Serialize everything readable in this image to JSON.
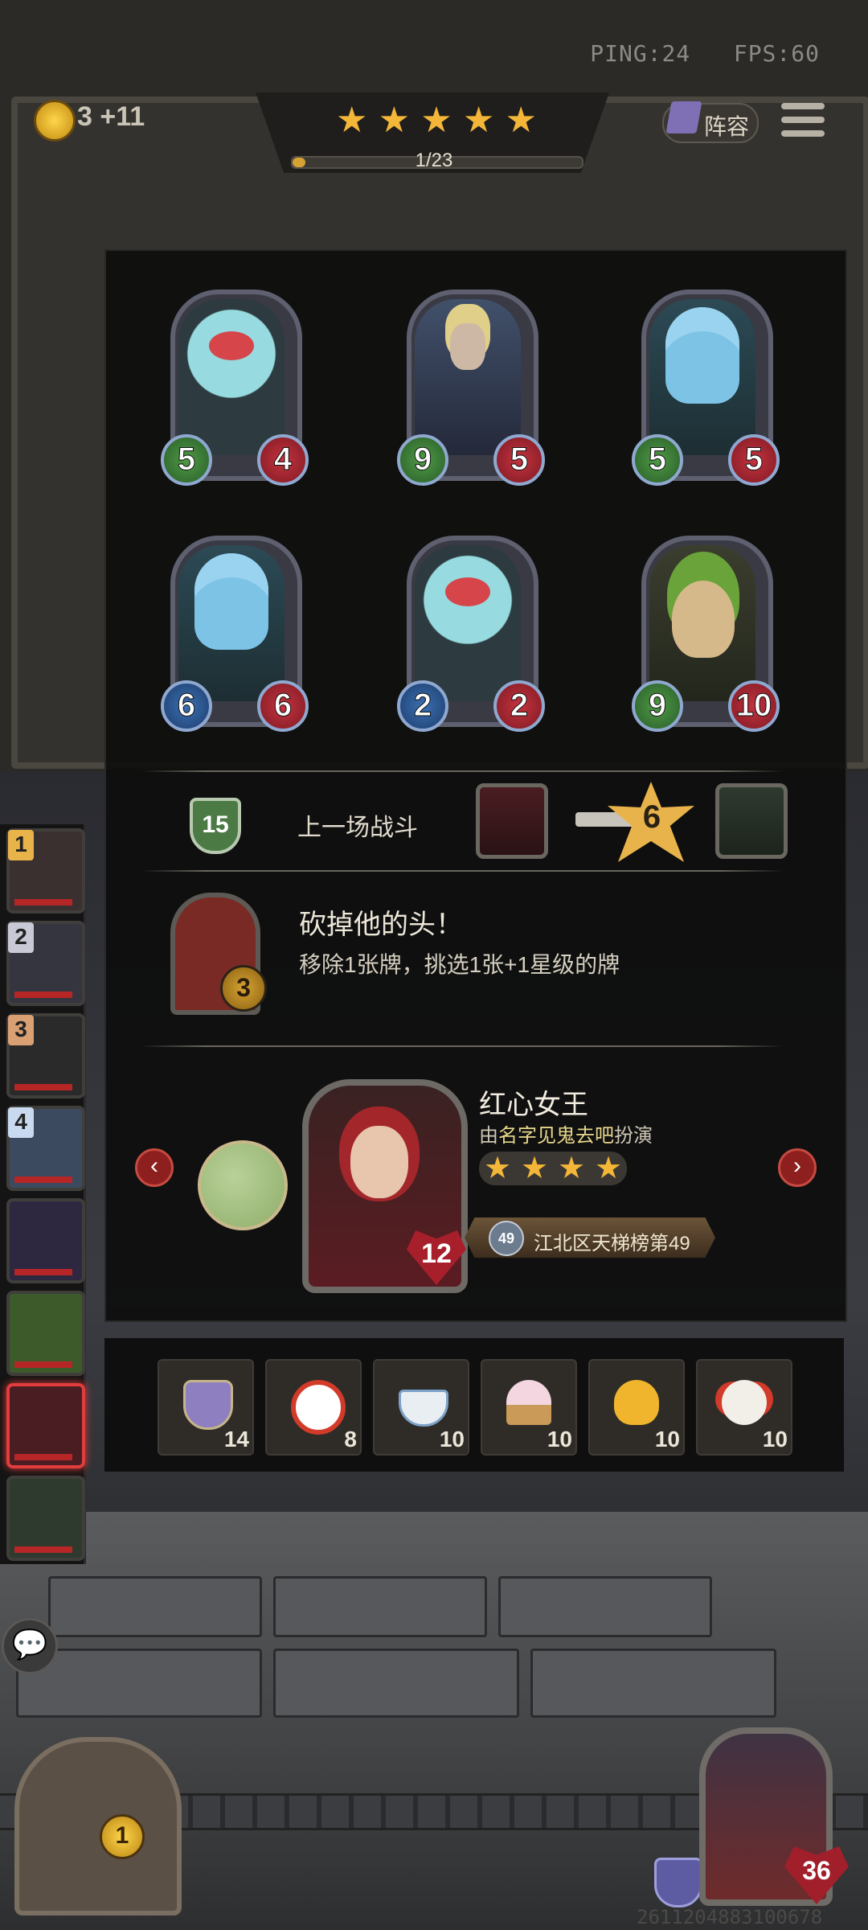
{
  "hud": {
    "ping": "PING:24",
    "fps": "FPS:60",
    "coins": "3 +11",
    "round_progress": "1/23",
    "stars": [
      "★",
      "★",
      "★",
      "★",
      "★"
    ],
    "lineup_label": "阵容",
    "lineup_icon": "book-icon",
    "menu_icon": "hamburger-menu-icon"
  },
  "board": {
    "cards": [
      {
        "name": "fish-tank-unit",
        "attack": "5",
        "health": "4"
      },
      {
        "name": "elf-knight-unit",
        "attack": "9",
        "health": "5"
      },
      {
        "name": "mermaid-unit",
        "attack": "5",
        "health": "5"
      },
      {
        "name": "mermaid-unit",
        "attack": "6",
        "health": "6"
      },
      {
        "name": "fish-tank-unit",
        "attack": "2",
        "health": "2"
      },
      {
        "name": "sprout-unit",
        "attack": "9",
        "health": "10"
      }
    ]
  },
  "last_battle": {
    "shield_value": "15",
    "label": "上一场战斗",
    "damage": "6"
  },
  "trait": {
    "title": "砍掉他的头！",
    "description": "移除1张牌，挑选1张+1星级的牌",
    "level": "3"
  },
  "hero": {
    "name": "红心女王",
    "subtitle_prefix": "由",
    "player_name": "名字见鬼去吧",
    "subtitle_suffix": "扮演",
    "stars": [
      "★",
      "★",
      "★",
      "★"
    ],
    "health": "12",
    "rank_number": "49",
    "rank_text": "江北区天梯榜第49",
    "prev_arrow": "‹",
    "next_arrow": "›"
  },
  "items": [
    {
      "icon": "shield-icon",
      "count": "14"
    },
    {
      "icon": "alarm-clock-icon",
      "count": "8"
    },
    {
      "icon": "teacup-icon",
      "count": "10"
    },
    {
      "icon": "cupcake-icon",
      "count": "10"
    },
    {
      "icon": "duck-toy-icon",
      "count": "10"
    },
    {
      "icon": "clown-icon",
      "count": "10"
    }
  ],
  "roster": {
    "slots": [
      {
        "rank": "1",
        "color": "#e8b44a"
      },
      {
        "rank": "2",
        "color": "#c9c9d6"
      },
      {
        "rank": "3",
        "color": "#d9a074"
      },
      {
        "rank": "4",
        "color": "#c9d9f0"
      },
      {
        "rank": "",
        "color": ""
      },
      {
        "rank": "",
        "color": ""
      },
      {
        "rank": "",
        "color": ""
      },
      {
        "rank": "",
        "color": ""
      }
    ]
  },
  "bottom": {
    "shop_level": "1",
    "player_health": "36",
    "game_id": "2611204883100678",
    "chat_icon": "chat-bubble-icon"
  },
  "colors": {
    "star": "#f3b638",
    "attack": "#4f9a45",
    "health": "#a61f2b",
    "active_slot": "#e23c3c"
  }
}
